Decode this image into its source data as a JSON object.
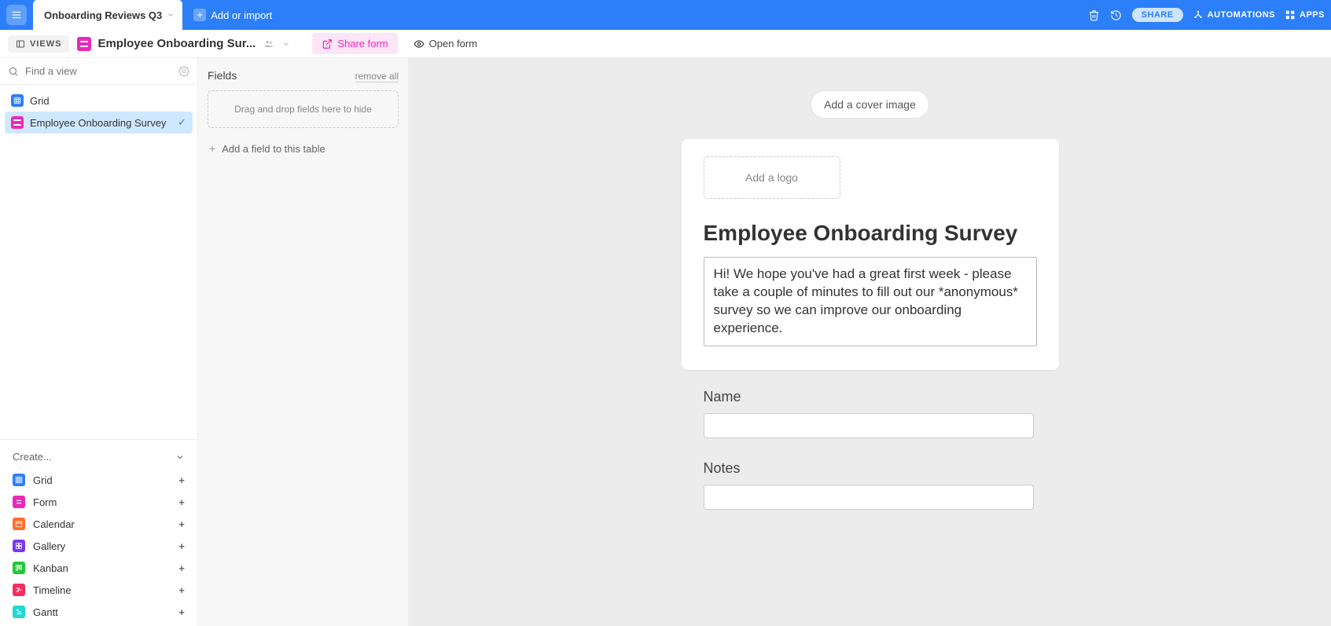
{
  "topbar": {
    "tab_label": "Onboarding Reviews Q3",
    "add_or_import": "Add or import",
    "share": "SHARE",
    "automations": "AUTOMATIONS",
    "apps": "APPS"
  },
  "viewbar": {
    "views_button": "VIEWS",
    "view_name": "Employee Onboarding Sur...",
    "share_form": "Share form",
    "open_form": "Open form"
  },
  "sidebar": {
    "search_placeholder": "Find a view",
    "views": [
      {
        "label": "Grid",
        "type": "grid",
        "active": false
      },
      {
        "label": "Employee Onboarding Survey",
        "type": "form",
        "active": true
      }
    ],
    "create_label": "Create...",
    "create_options": [
      {
        "label": "Grid",
        "color": "#2d7ff9",
        "icon": "grid"
      },
      {
        "label": "Form",
        "color": "#e929ba",
        "icon": "form"
      },
      {
        "label": "Calendar",
        "color": "#ff6f2c",
        "icon": "calendar"
      },
      {
        "label": "Gallery",
        "color": "#7c37ef",
        "icon": "gallery"
      },
      {
        "label": "Kanban",
        "color": "#20c933",
        "icon": "kanban"
      },
      {
        "label": "Timeline",
        "color": "#f82b60",
        "icon": "timeline"
      },
      {
        "label": "Gantt",
        "color": "#20d9d2",
        "icon": "gantt"
      }
    ]
  },
  "fields_panel": {
    "title": "Fields",
    "remove_all": "remove all",
    "dropzone_text": "Drag and drop fields here to hide",
    "add_field": "Add a field to this table"
  },
  "canvas": {
    "cover_button": "Add a cover image",
    "logo_button": "Add a logo",
    "form_title": "Employee Onboarding Survey",
    "form_description": "Hi! We hope you've had a great first week - please take a couple of minutes to fill out our *anonymous* survey so we can improve our onboarding experience.",
    "questions": [
      {
        "label": "Name"
      },
      {
        "label": "Notes"
      }
    ]
  }
}
